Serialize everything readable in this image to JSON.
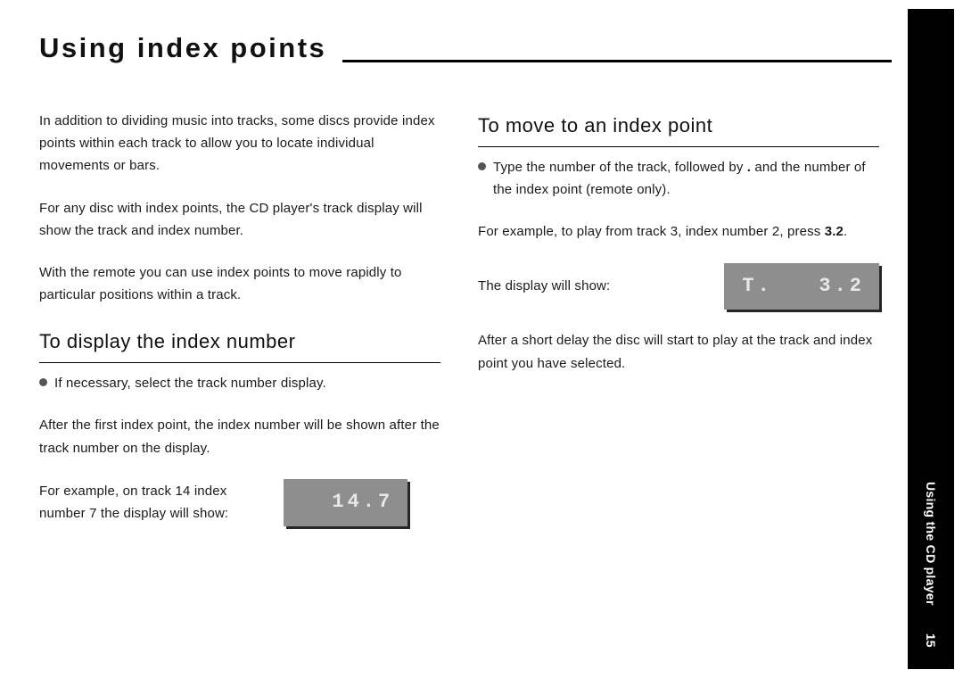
{
  "title": "Using index points",
  "side": {
    "label": "Using the CD player",
    "page": "15"
  },
  "left": {
    "p1": "In addition to dividing music into tracks, some discs provide index points within each track to allow you to locate individual movements or bars.",
    "p2": "For any disc with index points, the CD player's track display will show the track and index number.",
    "p3": "With the remote you can use index points to move rapidly to particular positions within a track.",
    "h1": "To display the index number",
    "b1": "If necessary, select the track number display.",
    "p4": "After the first index point, the index number will be shown after the track number on the display.",
    "ex_lead": "For example, on track 14 index number 7 the display will show:",
    "ex_lcd": "  14.7"
  },
  "right": {
    "h1": "To move to an index point",
    "b1_a": "Type the number of the track, followed by ",
    "b1_dot": ".",
    "b1_b": " and the number of the index point (remote only).",
    "p2_a": "For example, to play from track 3, index number 2, press ",
    "p2_b": "3.2",
    "p2_c": ".",
    "ex_lead": "The display will show:",
    "ex_lcd": "T.   3.2",
    "p3": "After a short delay the disc will start to play at the track and index point you have selected."
  }
}
